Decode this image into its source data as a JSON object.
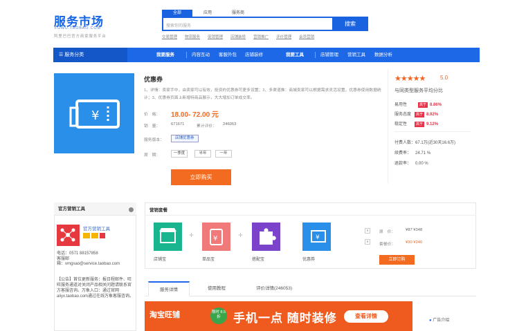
{
  "header": {
    "logo_cn": "服务市场",
    "logo_en": "FUWU.TAOBAO.COM",
    "slogan": "阿里巴巴官方商家服务平台",
    "search_tabs": [
      "全部",
      "应用",
      "服务商"
    ],
    "search_placeholder": "搜索你的服务",
    "search_button": "搜索",
    "hot_keywords": [
      "交易管理",
      "物流服务",
      "促销管理",
      "店铺装修",
      "营销推广",
      "评价管理",
      "会员营销"
    ]
  },
  "nav": {
    "category": "服务分类",
    "group1": "我要服务",
    "items1": [
      "内容互动",
      "客服外包",
      "店铺装修"
    ],
    "group2": "我要工具",
    "items2": [
      "店铺管理",
      "营销工具",
      "数据分析"
    ]
  },
  "product": {
    "title": "优惠券",
    "description": "1、详情：卖家手中，由卖家可以有效，投资的优惠券可更多设置；2、多渠道推：商城卖家可以根据需求灵活设置，优惠券使用数据统计；3、优惠券页面上新增特商品展示，大大增加订单成交率。",
    "price_label": "价　格：",
    "price_value": "18.00- 72.00 元",
    "sales_label": "销　量：",
    "sales_value": "671671",
    "total_label": "累计评价：",
    "total_value": "246053",
    "version_label": "服务版本：",
    "version_value": "店铺优惠券",
    "period_label": "周　期：",
    "periods": [
      "一季度",
      "半年",
      "一年"
    ],
    "buy_button": "立即购买"
  },
  "rating": {
    "stars": "★★★★★",
    "score": "5.0",
    "compare_title": "与同类型服务平均分比",
    "rows": [
      {
        "label": "易用性",
        "tag": "高于",
        "pct": "8.86%"
      },
      {
        "label": "服务态度",
        "tag": "高于",
        "pct": "8.92%"
      },
      {
        "label": "稳定性",
        "tag": "高于",
        "pct": "9.12%"
      }
    ],
    "users_label": "付费人数：",
    "users_value": "67.1万(近30天16.6万)",
    "renew_label": "续费率：",
    "renew_value": "24.71 %",
    "refund_label": "退款率：",
    "refund_value": "0.00 %"
  },
  "seller": {
    "panel_title": "官方营销工具",
    "shop_name": "官方营销工具",
    "phone_label": "电话：",
    "phone": "0571 88157858",
    "service_label": "客服邮",
    "email": "箱：vmgxao@service.taobao.com",
    "notice": "【公告】首位更新服务：报日程邮件、旺旺服务通道对关闭产品相关问题请联系官方客服咨询。万象入口：通过官网aliyx.taobao.com通过在线万象客服咨询。"
  },
  "package": {
    "title": "营销套餐",
    "items": [
      "店铺宝",
      "单品宝",
      "搭配宝",
      "优惠券"
    ],
    "price_label": "原　价：",
    "price_value": "¥87 ¥348",
    "pkg_price_label": "套餐价：",
    "pkg_price_value": "¥30 ¥240",
    "buy_button": "立即订购"
  },
  "tabs": [
    "服务详情",
    "使用教程",
    "评价详情(246053)"
  ],
  "banner": {
    "brand": "淘宝旺铺",
    "tag": "限时 8.5折",
    "headline": "手机一点 随时装修",
    "button": "查看详情"
  },
  "side": {
    "ad_label": "广告介绍"
  },
  "colors": {
    "brand": "#1d68e6",
    "accent": "#f36b21",
    "up": "#e8344a"
  }
}
